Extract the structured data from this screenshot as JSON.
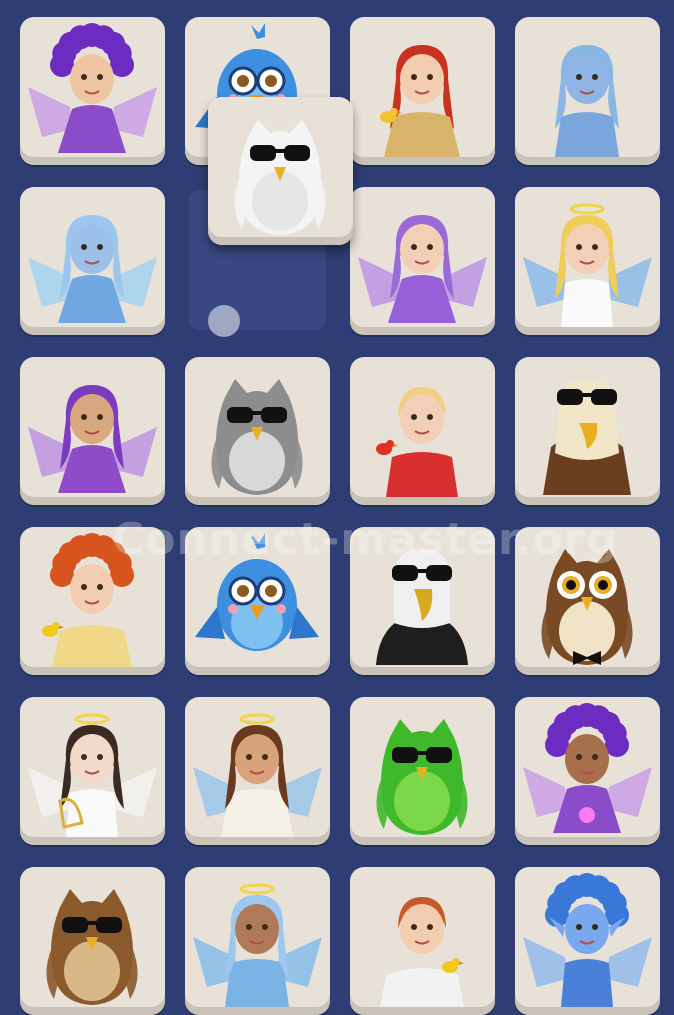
{
  "game": {
    "name": "emoji-connect-puzzle",
    "watermark": "Connect-master.org",
    "colors": {
      "background": "#2e3d73",
      "tile": "#e7e1d8",
      "tile_shadow": "#c9c2b8"
    }
  },
  "grid": {
    "rows": 6,
    "cols": 4,
    "tiles": [
      {
        "id": "r1c1",
        "icon": "purple-fairy-icon"
      },
      {
        "id": "r1c2",
        "icon": "blue-bird-glasses-icon"
      },
      {
        "id": "r1c3",
        "icon": "red-hair-woman-bird-icon"
      },
      {
        "id": "r1c4",
        "icon": "blue-mermaid-icon"
      },
      {
        "id": "r2c1",
        "icon": "blue-fairy-icon"
      },
      {
        "id": "r2c2",
        "icon": "empty-slot"
      },
      {
        "id": "r2c3",
        "icon": "lavender-fairy-icon"
      },
      {
        "id": "r2c4",
        "icon": "blonde-angel-icon"
      },
      {
        "id": "r3c1",
        "icon": "purple-fairy-praying-icon"
      },
      {
        "id": "r3c2",
        "icon": "gray-owl-sunglasses-icon"
      },
      {
        "id": "r3c3",
        "icon": "blonde-woman-parrot-icon"
      },
      {
        "id": "r3c4",
        "icon": "eagle-sunglasses-icon"
      },
      {
        "id": "r4c1",
        "icon": "redhead-woman-bird-icon"
      },
      {
        "id": "r4c2",
        "icon": "blue-bird-glasses-icon"
      },
      {
        "id": "r4c3",
        "icon": "eagle-hoodie-sunglasses-icon"
      },
      {
        "id": "r4c4",
        "icon": "brown-owl-bowtie-icon"
      },
      {
        "id": "r5c1",
        "icon": "white-angel-harp-icon"
      },
      {
        "id": "r5c2",
        "icon": "angel-woman-icon"
      },
      {
        "id": "r5c3",
        "icon": "green-owl-sunglasses-icon"
      },
      {
        "id": "r5c4",
        "icon": "purple-fairy-orb-icon"
      },
      {
        "id": "r6c1",
        "icon": "brown-owl-sunglasses-icon"
      },
      {
        "id": "r6c2",
        "icon": "blue-angel-icon"
      },
      {
        "id": "r6c3",
        "icon": "man-bird-icon"
      },
      {
        "id": "r6c4",
        "icon": "blue-elf-fairy-icon"
      }
    ]
  },
  "dragged_tile": {
    "icon": "white-owl-sunglasses-icon"
  }
}
